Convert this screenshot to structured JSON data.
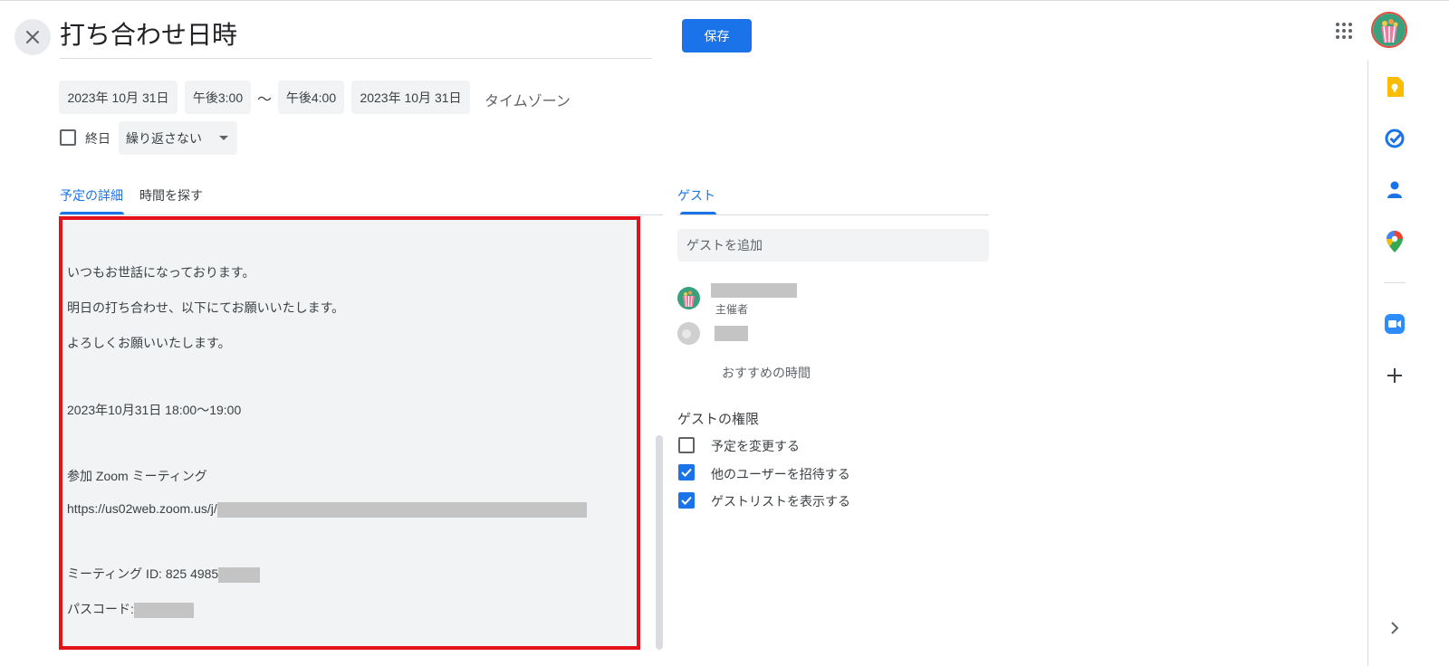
{
  "header": {
    "title": "打ち合わせ日時",
    "save_label": "保存"
  },
  "datetime": {
    "start_date": "2023年 10月 31日",
    "start_time": "午後3:00",
    "separator": "〜",
    "end_time": "午後4:00",
    "end_date": "2023年 10月 31日",
    "timezone": "タイムゾーン",
    "all_day_label": "終日",
    "all_day_checked": false,
    "repeat": "繰り返さない"
  },
  "tabs": [
    {
      "label": "予定の詳細",
      "active": true
    },
    {
      "label": "時間を探す",
      "active": false
    }
  ],
  "description": {
    "lines": [
      "いつもお世話になっております。",
      "明日の打ち合わせ、以下にてお願いいたします。",
      "よろしくお願いいたします。",
      "2023年10月31日 18:00〜19:00",
      "参加 Zoom ミーティング",
      "https://us02web.zoom.us/j/",
      "ミーティング ID: 825 4985",
      "パスコード:"
    ]
  },
  "guests": {
    "tab_label": "ゲスト",
    "add_placeholder": "ゲストを追加",
    "organizer_label": "主催者",
    "suggested_times": "おすすめの時間",
    "permissions_title": "ゲストの権限",
    "permissions": [
      {
        "label": "予定を変更する",
        "checked": false
      },
      {
        "label": "他のユーザーを招待する",
        "checked": true
      },
      {
        "label": "ゲストリストを表示する",
        "checked": true
      }
    ]
  },
  "side_rail": {
    "icons": [
      "keep-icon",
      "tasks-icon",
      "contacts-icon",
      "maps-icon",
      "zoom-icon",
      "add-icon",
      "chevron-right-icon"
    ]
  },
  "colors": {
    "accent": "#1a73e8",
    "highlight_border": "#e3121b",
    "field_bg": "#f1f3f4"
  }
}
